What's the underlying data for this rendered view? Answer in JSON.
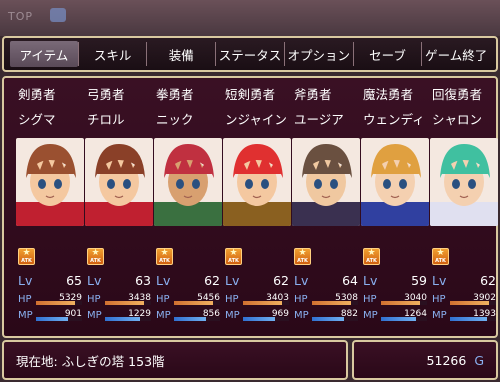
{
  "background": {
    "top_label": "TOP"
  },
  "menu": [
    {
      "label": "アイテム",
      "active": true
    },
    {
      "label": "スキル"
    },
    {
      "label": "装備"
    },
    {
      "label": "ステータス"
    },
    {
      "label": "オプション"
    },
    {
      "label": "セーブ"
    },
    {
      "label": "ゲーム終了"
    }
  ],
  "party": [
    {
      "class": "剣勇者",
      "name": "シグマ",
      "lv_label": "Lv",
      "lv": "65",
      "hp": "5329",
      "mp": "901",
      "hp_fill": 0.85,
      "mp_fill": 0.7,
      "atk": "ATK",
      "hair": "#9a5030",
      "skin": "#f4c8a0",
      "cloth": "#c02030"
    },
    {
      "class": "弓勇者",
      "name": "チロル",
      "lv_label": "Lv",
      "lv": "63",
      "hp": "3438",
      "mp": "1229",
      "hp_fill": 0.85,
      "mp_fill": 0.75,
      "atk": "ATK",
      "hair": "#8a4028",
      "skin": "#f4c8a0",
      "cloth": "#c02030"
    },
    {
      "class": "拳勇者",
      "name": "ニック",
      "lv_label": "Lv",
      "lv": "62",
      "hp": "5456",
      "mp": "856",
      "hp_fill": 0.85,
      "mp_fill": 0.7,
      "atk": "ATK",
      "hair": "#c03040",
      "skin": "#d8a070",
      "cloth": "#3a7040"
    },
    {
      "class": "短剣勇者",
      "name": "ンジャイン",
      "lv_label": "Lv",
      "lv": "62",
      "hp": "3403",
      "mp": "969",
      "hp_fill": 0.85,
      "mp_fill": 0.7,
      "atk": "ATK",
      "hair": "#e03030",
      "skin": "#f4c8a0",
      "cloth": "#8a6020"
    },
    {
      "class": "斧勇者",
      "name": "ユージア",
      "lv_label": "Lv",
      "lv": "64",
      "hp": "5308",
      "mp": "882",
      "hp_fill": 0.85,
      "mp_fill": 0.7,
      "atk": "ATK",
      "hair": "#6a5040",
      "skin": "#f0c8a0",
      "cloth": "#3a3050"
    },
    {
      "class": "魔法勇者",
      "name": "ウェンディ",
      "lv_label": "Lv",
      "lv": "59",
      "hp": "3040",
      "mp": "1264",
      "hp_fill": 0.85,
      "mp_fill": 0.75,
      "atk": "ATK",
      "hair": "#e0a040",
      "skin": "#f4d0b0",
      "cloth": "#3040a0"
    },
    {
      "class": "回復勇者",
      "name": "シャロン",
      "lv_label": "Lv",
      "lv": "62",
      "hp": "3902",
      "mp": "1393",
      "hp_fill": 0.85,
      "mp_fill": 0.8,
      "atk": "ATK",
      "hair": "#40c0a0",
      "skin": "#f4d0b0",
      "cloth": "#e0e0f0"
    }
  ],
  "stats_labels": {
    "hp": "HP",
    "mp": "MP"
  },
  "location": {
    "text": "現在地: ふしぎの塔 153階"
  },
  "gold": {
    "amount": "51266",
    "unit": "G"
  },
  "colors": {
    "frame": "#d9c9a0",
    "panel": "#3a1024",
    "accent_blue": "#8ab0f0"
  }
}
